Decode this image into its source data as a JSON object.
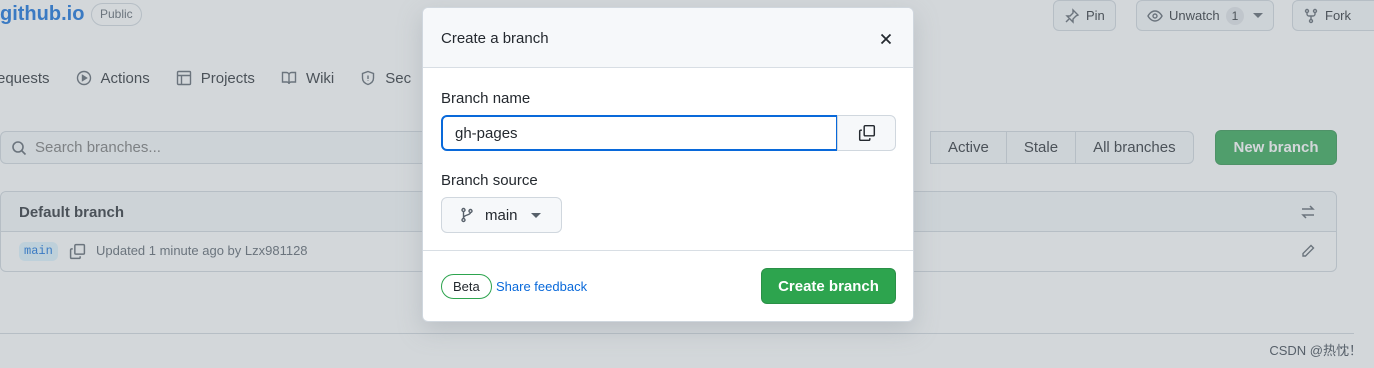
{
  "repo": {
    "name": "github.io",
    "visibility": "Public"
  },
  "header_actions": {
    "pin": "Pin",
    "unwatch": "Unwatch",
    "watch_count": "1",
    "fork": "Fork"
  },
  "nav": {
    "items": [
      {
        "label": "equests",
        "icon": "pull-request-icon"
      },
      {
        "label": "Actions",
        "icon": "play-icon"
      },
      {
        "label": "Projects",
        "icon": "table-icon"
      },
      {
        "label": "Wiki",
        "icon": "book-icon"
      },
      {
        "label": "Sec",
        "icon": "shield-icon"
      }
    ]
  },
  "branches": {
    "search_placeholder": "Search branches...",
    "filters": [
      "Active",
      "Stale",
      "All branches"
    ],
    "new_branch_label": "New branch",
    "default_branch_title": "Default branch",
    "default_branch": {
      "name": "main",
      "updated": "Updated 1 minute ago by Lzx981128"
    }
  },
  "modal": {
    "title": "Create a branch",
    "branch_name_label": "Branch name",
    "branch_name_value": "gh-pages",
    "branch_source_label": "Branch source",
    "branch_source_value": "main",
    "beta_label": "Beta",
    "feedback_label": "Share feedback",
    "create_label": "Create branch"
  },
  "watermark": "CSDN @热忱！",
  "colors": {
    "accent_blue": "#0969da",
    "primary_green": "#2da44e"
  }
}
